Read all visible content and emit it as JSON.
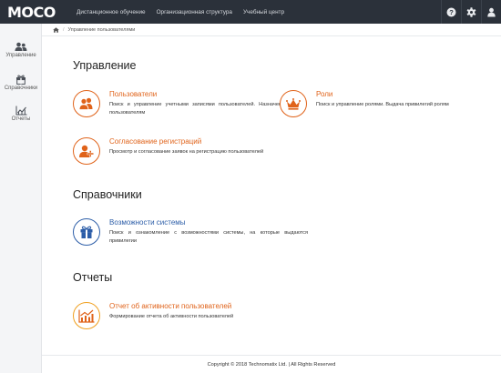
{
  "topbar": {
    "logo": "MOCO",
    "nav": [
      "Дистанционное обучение",
      "Организационная структура",
      "Учебный центр"
    ],
    "icons": [
      "help-icon",
      "gear-icon",
      "user-icon"
    ]
  },
  "sidebar": {
    "items": [
      {
        "label": "Управление",
        "icon": "users-icon"
      },
      {
        "label": "Справочники",
        "icon": "gift-icon"
      },
      {
        "label": "Отчеты",
        "icon": "chart-icon"
      }
    ]
  },
  "breadcrumb": {
    "home_icon": "home-icon",
    "current": "Управление пользователями"
  },
  "sections": {
    "management": {
      "title": "Управление",
      "cards": [
        {
          "title": "Пользователи",
          "description": "Поиск и управление учетными записями пользователей. Назначение ролей пользователям"
        },
        {
          "title": "Роли",
          "description": "Поиск и управление ролями. Выдача привилегий ролям"
        },
        {
          "title": "Согласование регистраций",
          "description": "Просмотр и согласование заявок на регистрацию пользователей"
        }
      ]
    },
    "references": {
      "title": "Справочники",
      "cards": [
        {
          "title": "Возможности системы",
          "description": "Поиск и ознакомление с возможностями системы, на которые выдаются привилегии"
        }
      ]
    },
    "reports": {
      "title": "Отчеты",
      "cards": [
        {
          "title": "Отчет об активности пользователей",
          "description": "Формирование отчета об активности пользователей"
        }
      ]
    }
  },
  "footer": {
    "text": "Copyright © 2018 Technomatix Ltd. | All Rights Reserved"
  },
  "colors": {
    "orange": "#e0631a",
    "blue": "#2d5ea8",
    "gold": "#f0a020",
    "topbar": "#2b313a"
  }
}
